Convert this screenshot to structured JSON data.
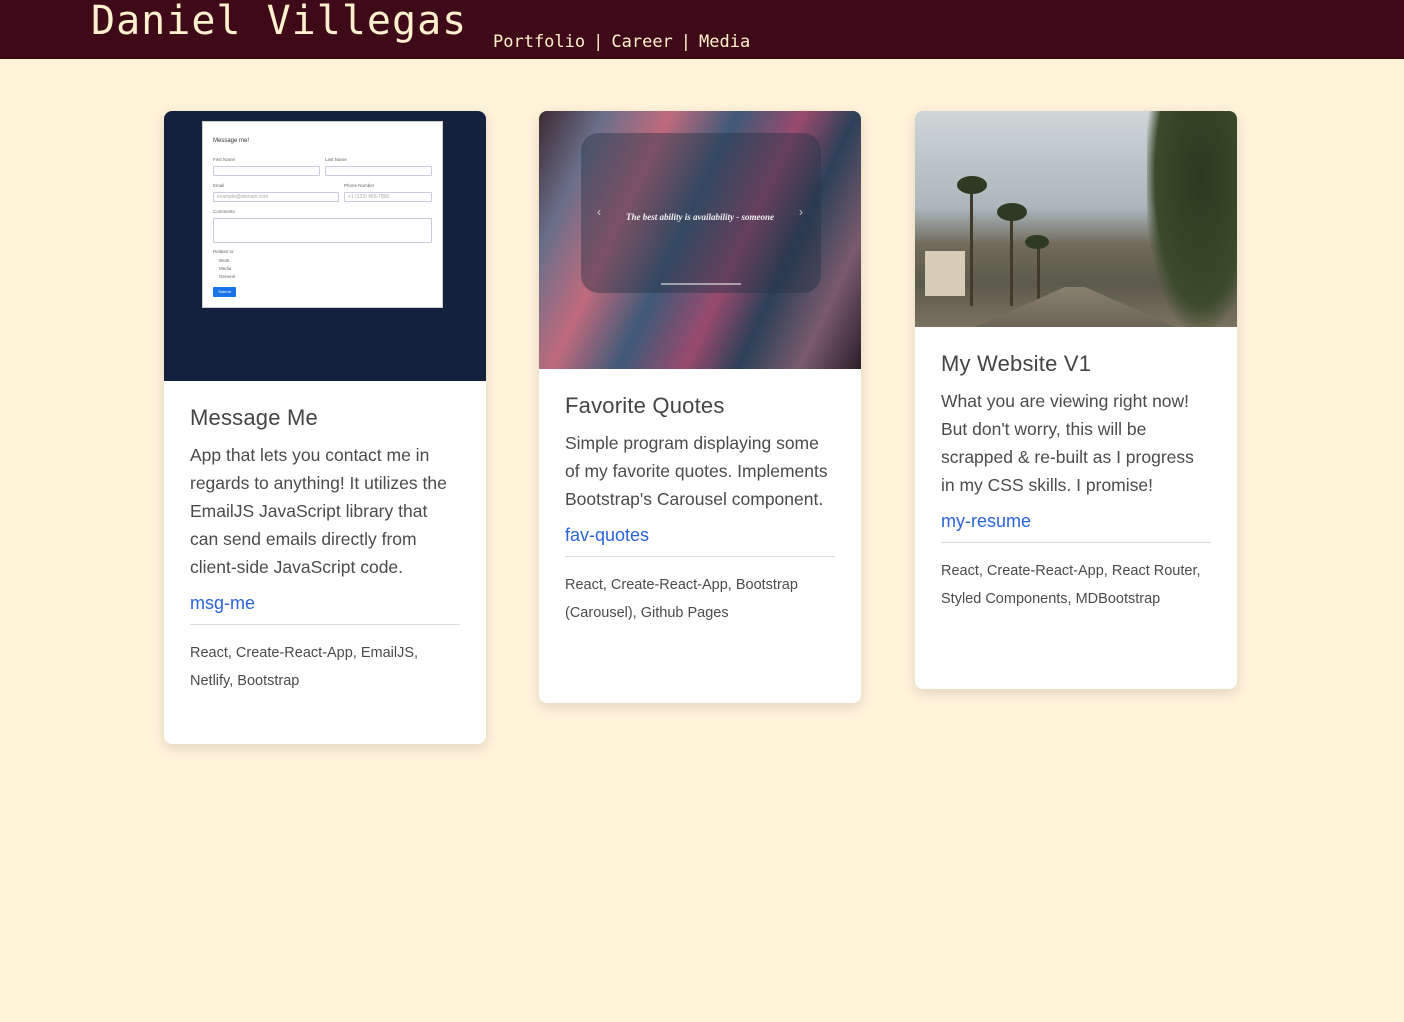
{
  "header": {
    "brand": "Daniel Villegas",
    "nav": [
      "Portfolio",
      "Career",
      "Media"
    ],
    "separator": "|"
  },
  "cards": [
    {
      "title": "Message Me",
      "description": "App that lets you contact me in regards to anything! It utilizes the EmailJS JavaScript library that can send emails directly from client-side JavaScript code.",
      "link": "msg-me",
      "tech": "React, Create-React-App, EmailJS, Netlify, Bootstrap",
      "image": {
        "title": "Message me!",
        "first_name": "First Name",
        "last_name": "Last Name",
        "email": "Email",
        "email_placeholder": "example@domain.com",
        "phone": "Phone Number",
        "phone_placeholder": "+1 (123) 456-7890",
        "comments": "Comments",
        "related_to": "Relates to:",
        "options": [
          "Work",
          "Media",
          "General"
        ],
        "submit": "Submit"
      }
    },
    {
      "title": "Favorite Quotes",
      "description": "Simple program displaying some of my favorite quotes. Implements Bootstrap's Carousel component.",
      "link": "fav-quotes",
      "tech": "React, Create-React-App, Bootstrap (Carousel), Github Pages",
      "image": {
        "quote": "The best ability is availability - someone"
      }
    },
    {
      "title": "My Website V1",
      "description": "What you are viewing right now! But don't worry, this will be scrapped & re-built as I progress in my CSS skills. I promise!",
      "link": "my-resume",
      "tech": "React, Create-React-App, React Router, Styled Components, MDBootstrap"
    }
  ],
  "colors": {
    "background": "#fff3da",
    "header": "#3f0a17",
    "header_text": "#fff0cf",
    "link": "#2a64d6"
  }
}
